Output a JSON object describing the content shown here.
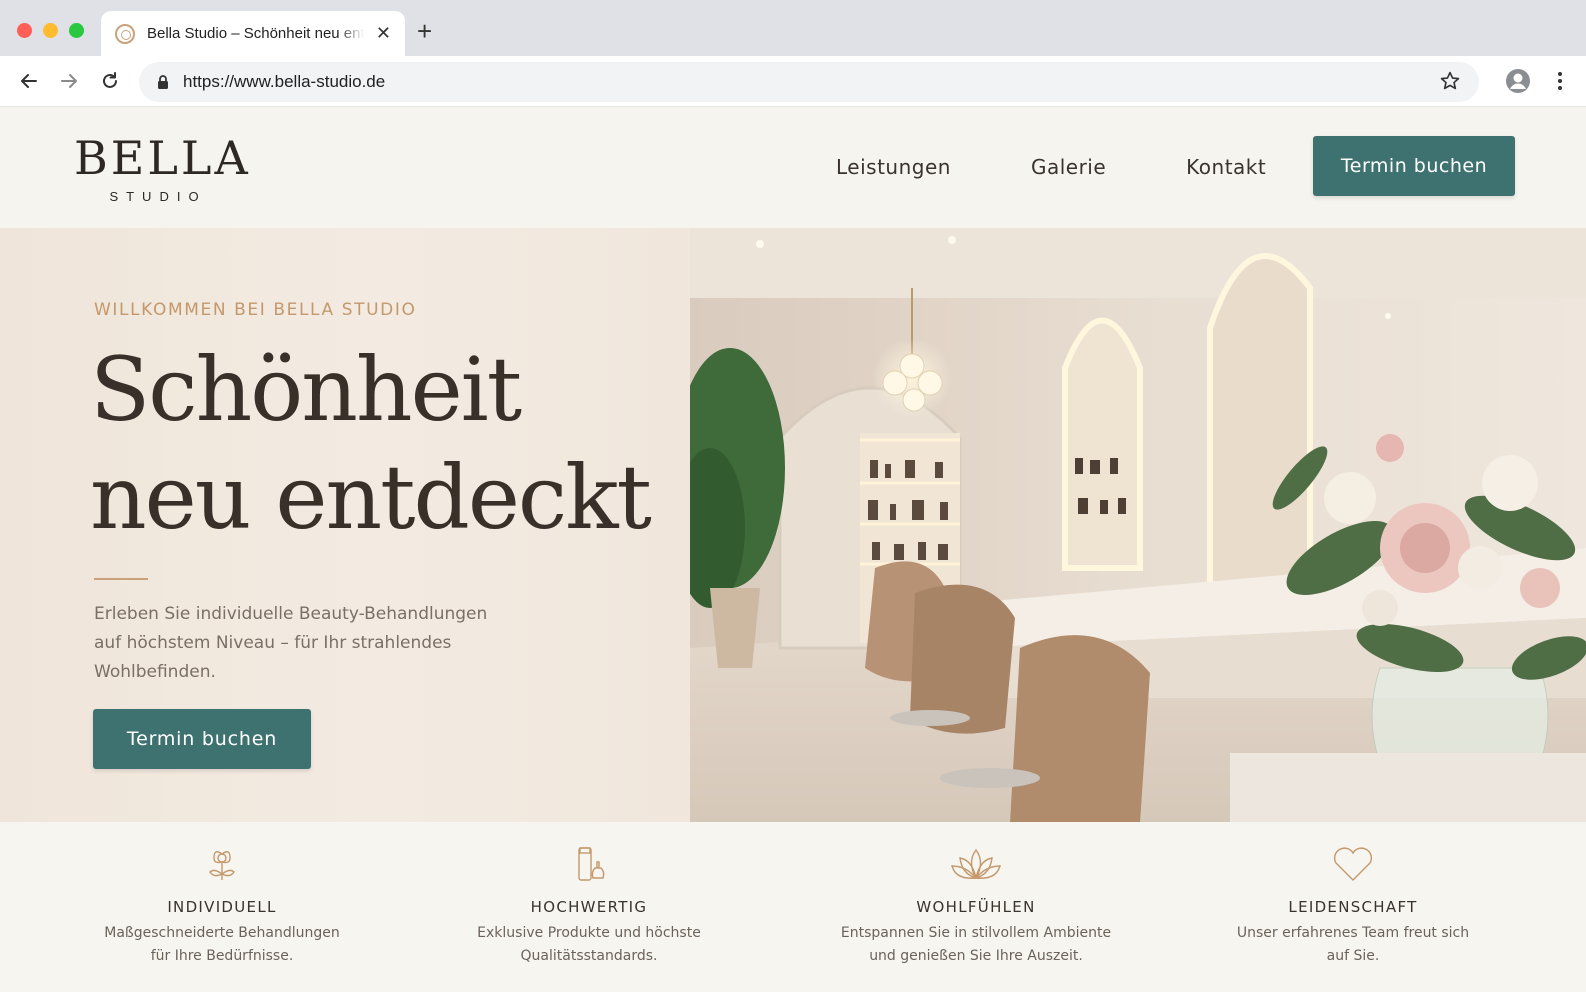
{
  "browser": {
    "tab_title": "Bella Studio – Schönheit neu entdeckt",
    "url": "https://www.bella-studio.de"
  },
  "header": {
    "logo_main": "BELLA",
    "logo_sub": "STUDIO",
    "nav": [
      {
        "label": "Leistungen"
      },
      {
        "label": "Galerie"
      },
      {
        "label": "Kontakt"
      }
    ],
    "cta": "Termin buchen"
  },
  "hero": {
    "eyebrow": "WILLKOMMEN BEI BELLA STUDIO",
    "headline_line1": "Schönheit",
    "headline_line2": "neu entdeckt",
    "text": "Erleben Sie individuelle Beauty-Behandlungen auf höchstem Niveau – für Ihr strahlendes Wohlbefinden.",
    "cta": "Termin buchen"
  },
  "features": [
    {
      "icon": "flower-icon",
      "title": "INDIVIDUELL",
      "desc_line1": "Maßgeschneiderte Behandlungen",
      "desc_line2": "für Ihre Bedürfnisse."
    },
    {
      "icon": "cosmetics-icon",
      "title": "HOCHWERTIG",
      "desc_line1": "Exklusive Produkte und höchste",
      "desc_line2": "Qualitätsstandards."
    },
    {
      "icon": "lotus-icon",
      "title": "WOHLFÜHLEN",
      "desc_line1": "Entspannen Sie in stilvollem Ambiente",
      "desc_line2": "und genießen Sie Ihre Auszeit."
    },
    {
      "icon": "heart-icon",
      "title": "LEIDENSCHAFT",
      "desc_line1": "Unser erfahrenes Team freut sich",
      "desc_line2": "auf Sie."
    }
  ],
  "colors": {
    "accent_teal": "#3e7270",
    "gold": "#c4986b",
    "background": "#f6f4ef"
  }
}
